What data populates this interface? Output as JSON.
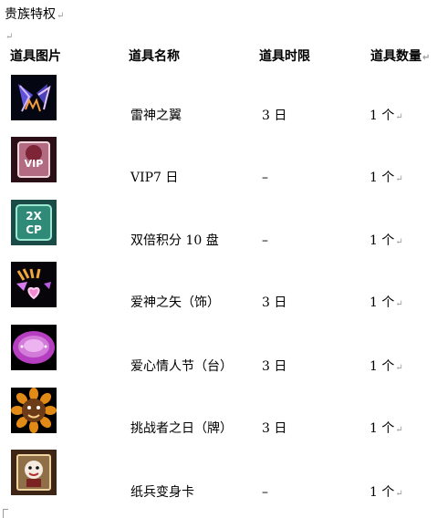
{
  "title": "贵族特权",
  "paragraph_mark": "↵",
  "headers": {
    "image": "道具图片",
    "name": "道具名称",
    "duration": "道具时限",
    "quantity": "道具数量"
  },
  "items": [
    {
      "icon": "thunder-wings-icon",
      "name": "雷神之翼",
      "duration": "3 日",
      "quantity": "1 个"
    },
    {
      "icon": "vip-card-icon",
      "name": "VIP7 日",
      "duration": "–",
      "quantity": "1 个"
    },
    {
      "icon": "double-points-icon",
      "name": "双倍积分 10 盘",
      "duration": "–",
      "quantity": "1 个"
    },
    {
      "icon": "cupid-arrow-icon",
      "name": "爱神之矢（饰）",
      "duration": "3 日",
      "quantity": "1 个"
    },
    {
      "icon": "love-platform-icon",
      "name": "爱心情人节（台）",
      "duration": "3 日",
      "quantity": "1 个"
    },
    {
      "icon": "challenger-sun-icon",
      "name": "挑战者之日（牌）",
      "duration": "3 日",
      "quantity": "1 个"
    },
    {
      "icon": "paper-soldier-card-icon",
      "name": "纸兵变身卡",
      "duration": "–",
      "quantity": "1 个"
    }
  ],
  "thumb_labels": {
    "vip": "VIP",
    "double_top": "2X",
    "double_bottom": "CP"
  }
}
